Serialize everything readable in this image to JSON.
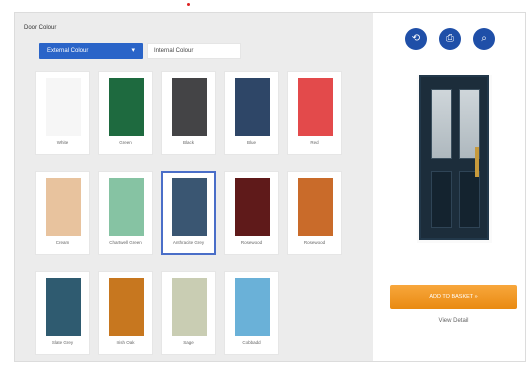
{
  "header": {
    "title": "Door Colour",
    "dropdown_label": "External Colour",
    "internal_label": "Internal Colour"
  },
  "swatches": [
    {
      "label": "White",
      "color": "#f6f6f6"
    },
    {
      "label": "Green",
      "color": "#1e6a3f"
    },
    {
      "label": "Black",
      "color": "#444446"
    },
    {
      "label": "Blue",
      "color": "#2e4667"
    },
    {
      "label": "Red",
      "color": "#e34a4b"
    },
    {
      "label": "Cream",
      "color": "#e8c39e"
    },
    {
      "label": "Chartwell Green",
      "color": "#86c3a3"
    },
    {
      "label": "Anthracite Grey",
      "color": "#3a5672"
    },
    {
      "label": "Rosewood",
      "color": "#5f1a1a"
    },
    {
      "label": "Rosewood",
      "color": "#c96b2a"
    },
    {
      "label": "Slate Grey",
      "color": "#2f5b70"
    },
    {
      "label": "Irish Oak",
      "color": "#c7771f"
    },
    {
      "label": "Sage",
      "color": "#c9cdb3"
    },
    {
      "label": "Cobbadd",
      "color": "#6ab1d8"
    }
  ],
  "selected_index": 7,
  "preview": {
    "icons": [
      "rotate-icon",
      "save-icon",
      "zoom-icon"
    ],
    "add_button": "ADD TO BASKET  »",
    "view_detail": "View Detail"
  }
}
